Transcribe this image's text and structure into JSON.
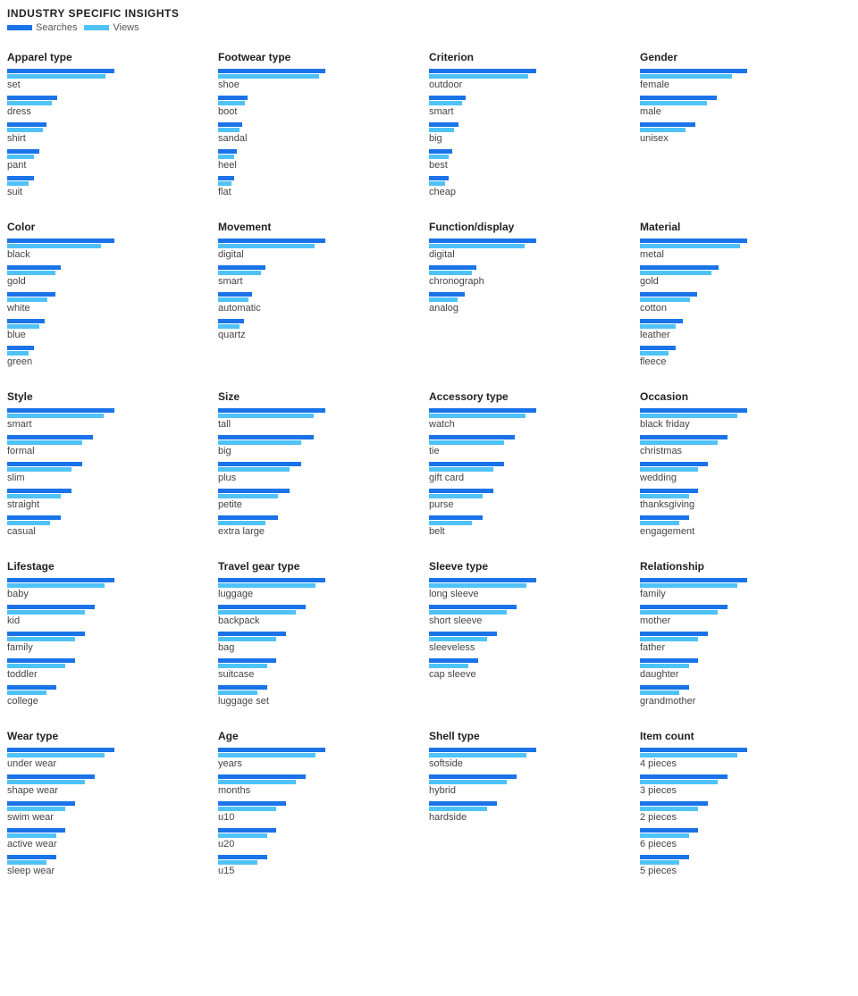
{
  "header": {
    "title": "INDUSTRY SPECIFIC INSIGHTS",
    "legend_searches": "Searches",
    "legend_views": "Views"
  },
  "sections": [
    {
      "id": "apparel-type",
      "title": "Apparel type",
      "items": [
        {
          "label": "set",
          "s": 60,
          "v": 55
        },
        {
          "label": "dress",
          "s": 28,
          "v": 25
        },
        {
          "label": "shirt",
          "s": 22,
          "v": 20
        },
        {
          "label": "pant",
          "s": 18,
          "v": 15
        },
        {
          "label": "suit",
          "s": 15,
          "v": 12
        }
      ]
    },
    {
      "id": "footwear-type",
      "title": "Footwear type",
      "items": [
        {
          "label": "shoe",
          "s": 80,
          "v": 75
        },
        {
          "label": "boot",
          "s": 22,
          "v": 20
        },
        {
          "label": "sandal",
          "s": 18,
          "v": 16
        },
        {
          "label": "heel",
          "s": 14,
          "v": 12
        },
        {
          "label": "flat",
          "s": 12,
          "v": 10
        }
      ]
    },
    {
      "id": "criterion",
      "title": "Criterion",
      "items": [
        {
          "label": "outdoor",
          "s": 65,
          "v": 60
        },
        {
          "label": "smart",
          "s": 22,
          "v": 20
        },
        {
          "label": "big",
          "s": 18,
          "v": 15
        },
        {
          "label": "best",
          "s": 14,
          "v": 12
        },
        {
          "label": "cheap",
          "s": 12,
          "v": 10
        }
      ]
    },
    {
      "id": "gender",
      "title": "Gender",
      "items": [
        {
          "label": "female",
          "s": 35,
          "v": 30
        },
        {
          "label": "male",
          "s": 25,
          "v": 22
        },
        {
          "label": "unisex",
          "s": 18,
          "v": 15
        }
      ]
    },
    {
      "id": "color",
      "title": "Color",
      "items": [
        {
          "label": "black",
          "s": 40,
          "v": 35
        },
        {
          "label": "gold",
          "s": 20,
          "v": 18
        },
        {
          "label": "white",
          "s": 18,
          "v": 15
        },
        {
          "label": "blue",
          "s": 14,
          "v": 12
        },
        {
          "label": "green",
          "s": 10,
          "v": 8
        }
      ]
    },
    {
      "id": "movement",
      "title": "Movement",
      "items": [
        {
          "label": "digital",
          "s": 50,
          "v": 45
        },
        {
          "label": "smart",
          "s": 22,
          "v": 20
        },
        {
          "label": "automatic",
          "s": 16,
          "v": 14
        },
        {
          "label": "quartz",
          "s": 12,
          "v": 10
        }
      ]
    },
    {
      "id": "function-display",
      "title": "Function/display",
      "items": [
        {
          "label": "digital",
          "s": 45,
          "v": 40
        },
        {
          "label": "chronograph",
          "s": 20,
          "v": 18
        },
        {
          "label": "analog",
          "s": 15,
          "v": 12
        }
      ]
    },
    {
      "id": "material",
      "title": "Material",
      "items": [
        {
          "label": "metal",
          "s": 30,
          "v": 28
        },
        {
          "label": "gold",
          "s": 22,
          "v": 20
        },
        {
          "label": "cotton",
          "s": 16,
          "v": 14
        },
        {
          "label": "leather",
          "s": 12,
          "v": 10
        },
        {
          "label": "fleece",
          "s": 10,
          "v": 8
        }
      ]
    },
    {
      "id": "style",
      "title": "Style",
      "items": [
        {
          "label": "smart",
          "s": 20,
          "v": 18
        },
        {
          "label": "formal",
          "s": 16,
          "v": 14
        },
        {
          "label": "slim",
          "s": 14,
          "v": 12
        },
        {
          "label": "straight",
          "s": 12,
          "v": 10
        },
        {
          "label": "casual",
          "s": 10,
          "v": 8
        }
      ]
    },
    {
      "id": "size",
      "title": "Size",
      "items": [
        {
          "label": "tall",
          "s": 18,
          "v": 16
        },
        {
          "label": "big",
          "s": 16,
          "v": 14
        },
        {
          "label": "plus",
          "s": 14,
          "v": 12
        },
        {
          "label": "petite",
          "s": 12,
          "v": 10
        },
        {
          "label": "extra large",
          "s": 10,
          "v": 8
        }
      ]
    },
    {
      "id": "accessory-type",
      "title": "Accessory type",
      "items": [
        {
          "label": "watch",
          "s": 20,
          "v": 18
        },
        {
          "label": "tie",
          "s": 16,
          "v": 14
        },
        {
          "label": "gift card",
          "s": 14,
          "v": 12
        },
        {
          "label": "purse",
          "s": 12,
          "v": 10
        },
        {
          "label": "belt",
          "s": 10,
          "v": 8
        }
      ]
    },
    {
      "id": "occasion",
      "title": "Occasion",
      "items": [
        {
          "label": "black friday",
          "s": 22,
          "v": 20
        },
        {
          "label": "christmas",
          "s": 18,
          "v": 16
        },
        {
          "label": "wedding",
          "s": 14,
          "v": 12
        },
        {
          "label": "thanksgiving",
          "s": 12,
          "v": 10
        },
        {
          "label": "engagement",
          "s": 10,
          "v": 8
        }
      ]
    },
    {
      "id": "lifestage",
      "title": "Lifestage",
      "items": [
        {
          "label": "baby",
          "s": 22,
          "v": 20
        },
        {
          "label": "kid",
          "s": 18,
          "v": 16
        },
        {
          "label": "family",
          "s": 16,
          "v": 14
        },
        {
          "label": "toddler",
          "s": 14,
          "v": 12
        },
        {
          "label": "college",
          "s": 10,
          "v": 8
        }
      ]
    },
    {
      "id": "travel-gear-type",
      "title": "Travel gear type",
      "items": [
        {
          "label": "luggage",
          "s": 22,
          "v": 20
        },
        {
          "label": "backpack",
          "s": 18,
          "v": 16
        },
        {
          "label": "bag",
          "s": 14,
          "v": 12
        },
        {
          "label": "suitcase",
          "s": 12,
          "v": 10
        },
        {
          "label": "luggage set",
          "s": 10,
          "v": 8
        }
      ]
    },
    {
      "id": "sleeve-type",
      "title": "Sleeve type",
      "items": [
        {
          "label": "long sleeve",
          "s": 22,
          "v": 20
        },
        {
          "label": "short sleeve",
          "s": 18,
          "v": 16
        },
        {
          "label": "sleeveless",
          "s": 14,
          "v": 12
        },
        {
          "label": "cap sleeve",
          "s": 10,
          "v": 8
        }
      ]
    },
    {
      "id": "relationship",
      "title": "Relationship",
      "items": [
        {
          "label": "family",
          "s": 22,
          "v": 20
        },
        {
          "label": "mother",
          "s": 18,
          "v": 16
        },
        {
          "label": "father",
          "s": 14,
          "v": 12
        },
        {
          "label": "daughter",
          "s": 12,
          "v": 10
        },
        {
          "label": "grandmother",
          "s": 10,
          "v": 8
        }
      ]
    },
    {
      "id": "wear-type",
      "title": "Wear type",
      "items": [
        {
          "label": "under wear",
          "s": 22,
          "v": 20
        },
        {
          "label": "shape wear",
          "s": 18,
          "v": 16
        },
        {
          "label": "swim wear",
          "s": 14,
          "v": 12
        },
        {
          "label": "active wear",
          "s": 12,
          "v": 10
        },
        {
          "label": "sleep wear",
          "s": 10,
          "v": 8
        }
      ]
    },
    {
      "id": "age",
      "title": "Age",
      "items": [
        {
          "label": "years",
          "s": 22,
          "v": 20
        },
        {
          "label": "months",
          "s": 18,
          "v": 16
        },
        {
          "label": "u10",
          "s": 14,
          "v": 12
        },
        {
          "label": "u20",
          "s": 12,
          "v": 10
        },
        {
          "label": "u15",
          "s": 10,
          "v": 8
        }
      ]
    },
    {
      "id": "shell-type",
      "title": "Shell type",
      "items": [
        {
          "label": "softside",
          "s": 22,
          "v": 20
        },
        {
          "label": "hybrid",
          "s": 18,
          "v": 16
        },
        {
          "label": "hardside",
          "s": 14,
          "v": 12
        }
      ]
    },
    {
      "id": "item-count",
      "title": "Item count",
      "items": [
        {
          "label": "4 pieces",
          "s": 22,
          "v": 20
        },
        {
          "label": "3 pieces",
          "s": 18,
          "v": 16
        },
        {
          "label": "2 pieces",
          "s": 14,
          "v": 12
        },
        {
          "label": "6 pieces",
          "s": 12,
          "v": 10
        },
        {
          "label": "5 pieces",
          "s": 10,
          "v": 8
        }
      ]
    }
  ]
}
